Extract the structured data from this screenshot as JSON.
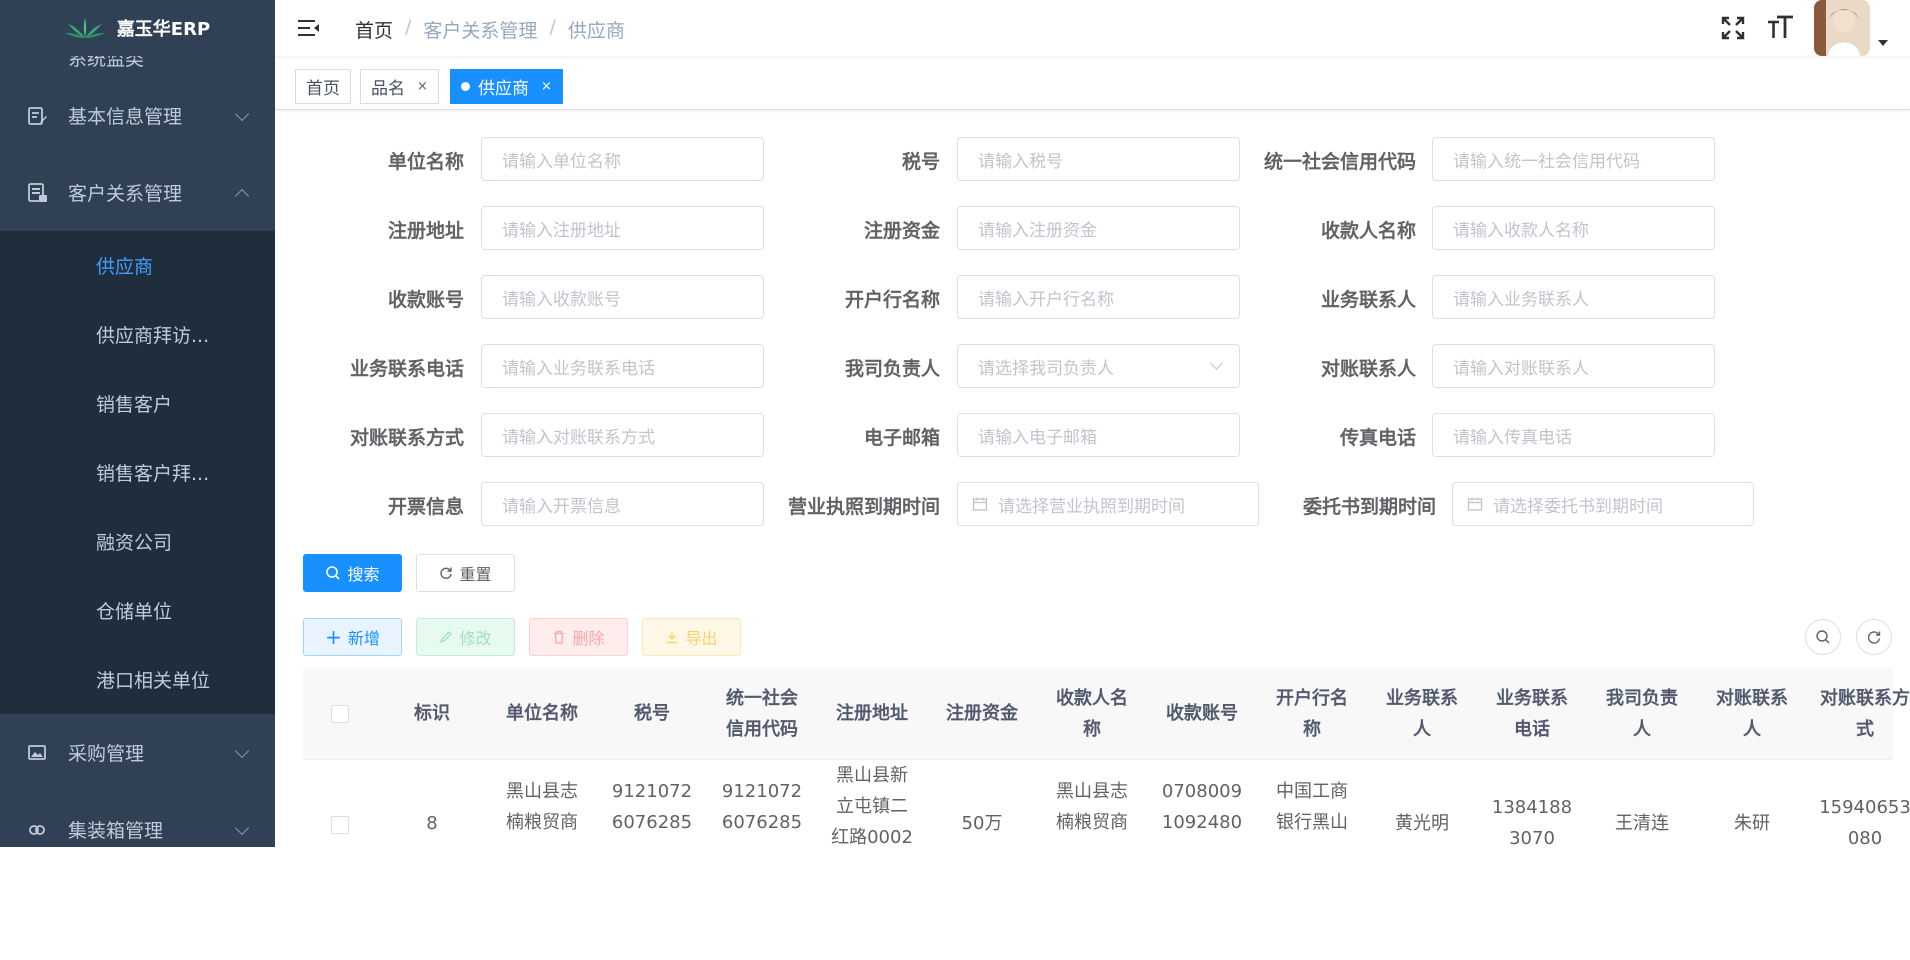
{
  "app": {
    "title": "嘉玉华ERP"
  },
  "sidebar": {
    "cut_text": "系统监类",
    "menus": [
      {
        "label": "基本信息管理"
      },
      {
        "label": "客户关系管理"
      }
    ],
    "subitems": [
      {
        "label": "供应商"
      },
      {
        "label": "供应商拜访..."
      },
      {
        "label": "销售客户"
      },
      {
        "label": "销售客户拜..."
      },
      {
        "label": "融资公司"
      },
      {
        "label": "仓储单位"
      },
      {
        "label": "港口相关单位"
      }
    ],
    "bottom_menus": [
      {
        "label": "采购管理"
      },
      {
        "label": "集装箱管理"
      }
    ]
  },
  "breadcrumb": {
    "home": "首页",
    "sep": "/",
    "level1": "客户关系管理",
    "level2": "供应商"
  },
  "tags": {
    "home": "首页",
    "tag1": "品名",
    "tag2": "供应商",
    "close": "×"
  },
  "form": {
    "fields": [
      {
        "label": "单位名称",
        "placeholder": "请输入单位名称"
      },
      {
        "label": "税号",
        "placeholder": "请输入税号"
      },
      {
        "label": "统一社会信用代码",
        "placeholder": "请输入统一社会信用代码"
      },
      {
        "label": "注册地址",
        "placeholder": "请输入注册地址"
      },
      {
        "label": "注册资金",
        "placeholder": "请输入注册资金"
      },
      {
        "label": "收款人名称",
        "placeholder": "请输入收款人名称"
      },
      {
        "label": "收款账号",
        "placeholder": "请输入收款账号"
      },
      {
        "label": "开户行名称",
        "placeholder": "请输入开户行名称"
      },
      {
        "label": "业务联系人",
        "placeholder": "请输入业务联系人"
      },
      {
        "label": "业务联系电话",
        "placeholder": "请输入业务联系电话"
      },
      {
        "label": "我司负责人",
        "placeholder": "请选择我司负责人"
      },
      {
        "label": "对账联系人",
        "placeholder": "请输入对账联系人"
      },
      {
        "label": "对账联系方式",
        "placeholder": "请输入对账联系方式"
      },
      {
        "label": "电子邮箱",
        "placeholder": "请输入电子邮箱"
      },
      {
        "label": "传真电话",
        "placeholder": "请输入传真电话"
      },
      {
        "label": "开票信息",
        "placeholder": "请输入开票信息"
      },
      {
        "label": "营业执照到期时间",
        "placeholder": "请选择营业执照到期时间"
      },
      {
        "label": "委托书到期时间",
        "placeholder": "请选择委托书到期时间"
      }
    ],
    "search_label": "搜索",
    "reset_label": "重置"
  },
  "toolbar": {
    "add": "新增",
    "edit": "修改",
    "delete": "删除",
    "export": "导出"
  },
  "table": {
    "headers": [
      "标识",
      "单位名称",
      "税号",
      "统一社会信用代码",
      "注册地址",
      "注册资金",
      "收款人名称",
      "收款账号",
      "开户行名称",
      "业务联系人",
      "业务联系电话",
      "我司负责人",
      "对账联系人",
      "对账联系方式"
    ],
    "rows": [
      {
        "id": "8",
        "name": "黑山县志楠粮贸商",
        "tax": "91210726076285",
        "credit": "91210726076285",
        "address": "黑山县新立屯镇二红路0002",
        "capital": "50万",
        "payee": "黑山县志楠粮贸商",
        "account": "07080091092480",
        "bank": "中国工商银行黑山",
        "contact": "黄光明",
        "phone": "13841883070",
        "owner": "王清连",
        "recon_contact": "朱研",
        "recon_phone": "15940653080"
      }
    ]
  }
}
